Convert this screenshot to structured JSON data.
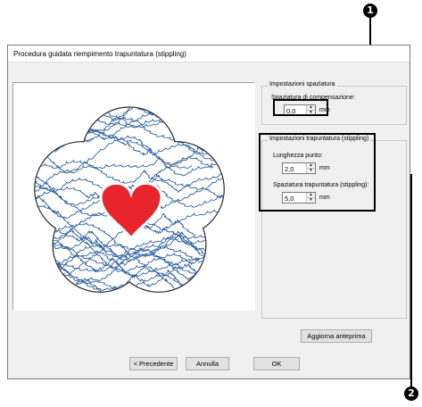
{
  "window": {
    "title": "Procedura guidata riempimento trapuntatura (stippling)"
  },
  "spacing_group": {
    "title": "Impostazioni spaziatura",
    "compensation_label": "Spaziatura di compensazione:",
    "compensation_value": "0,0",
    "unit": "mm"
  },
  "stipple_group": {
    "title": "Impostazioni trapuntatura (stippling)",
    "stitch_length_label": "Lunghezza punto:",
    "stitch_length_value": "2,0",
    "stitch_spacing_label": "Spaziatura trapuntatura (stippling):",
    "stitch_spacing_value": "5,0",
    "unit": "mm"
  },
  "buttons": {
    "refresh": "Aggiorna anteprima",
    "back": "< Precedente",
    "cancel": "Annulla",
    "ok": "OK"
  },
  "callouts": {
    "first": "1",
    "second": "2"
  },
  "colors": {
    "stipple_line": "#2f5f9e",
    "heart": "#e8242c",
    "outline": "#222222"
  }
}
